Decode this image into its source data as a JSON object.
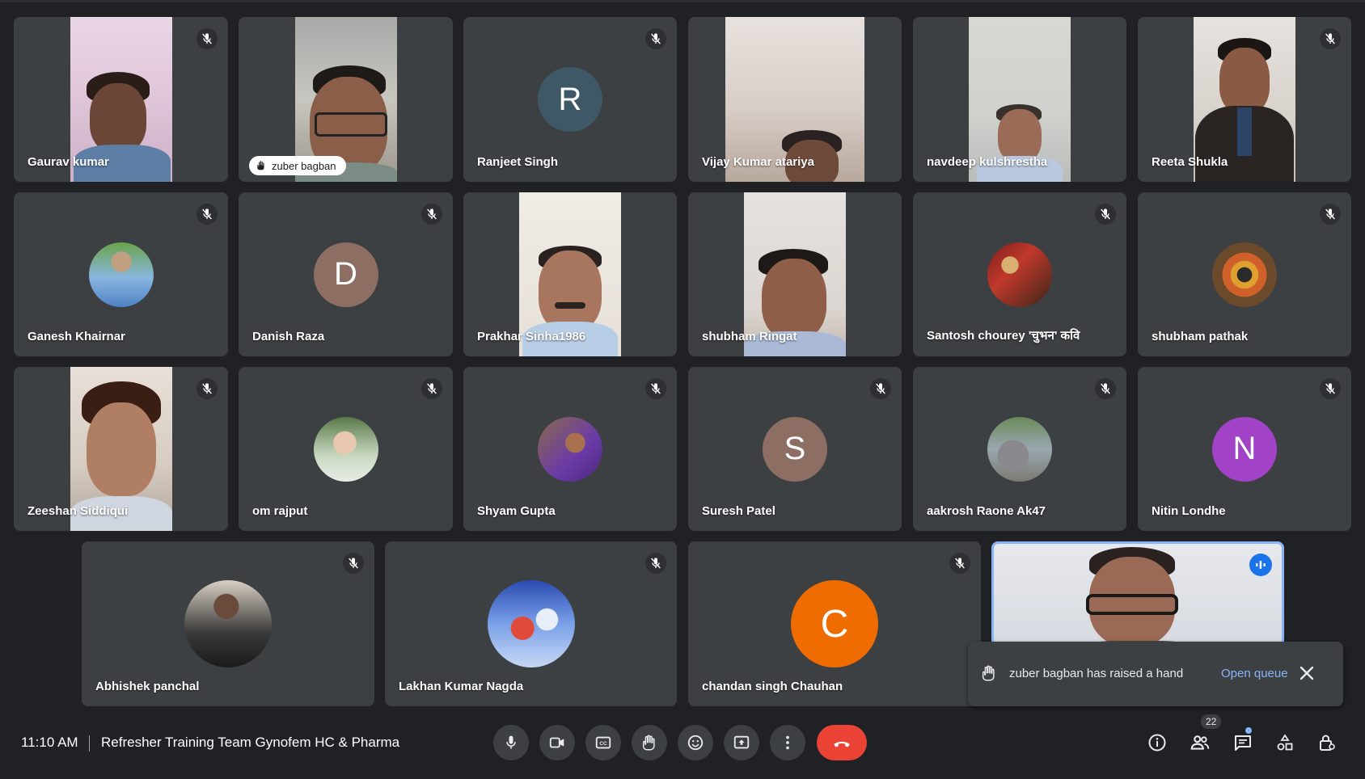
{
  "meeting": {
    "time": "11:10 AM",
    "title": "Refresher Training Team Gynofem HC & Pharma",
    "people_count": "22"
  },
  "participants": [
    {
      "name": "Gaurav kumar",
      "kind": "video"
    },
    {
      "name": "zuber bagban",
      "kind": "video",
      "hand_raised": true
    },
    {
      "name": "Ranjeet Singh",
      "kind": "letter",
      "letter": "R",
      "color": "#3f5868"
    },
    {
      "name": "Vijay Kumar atariya",
      "kind": "video"
    },
    {
      "name": "navdeep kulshrestha",
      "kind": "video"
    },
    {
      "name": "Reeta Shukla",
      "kind": "video"
    },
    {
      "name": "Ganesh Khairnar",
      "kind": "photo"
    },
    {
      "name": "Danish Raza",
      "kind": "letter",
      "letter": "D",
      "color": "#8d6e63"
    },
    {
      "name": "Prakhar Sinha1986",
      "kind": "video"
    },
    {
      "name": "shubham Ringat",
      "kind": "video"
    },
    {
      "name": "Santosh chourey 'चुभन' कवि",
      "kind": "photo"
    },
    {
      "name": "shubham pathak",
      "kind": "photo"
    },
    {
      "name": "Zeeshan Siddiqui",
      "kind": "video"
    },
    {
      "name": "om rajput",
      "kind": "photo"
    },
    {
      "name": "Shyam Gupta",
      "kind": "photo"
    },
    {
      "name": "Suresh Patel",
      "kind": "letter",
      "letter": "S",
      "color": "#8d6e63"
    },
    {
      "name": "aakrosh Raone Ak47",
      "kind": "photo"
    },
    {
      "name": "Nitin Londhe",
      "kind": "letter",
      "letter": "N",
      "color": "#a142c7"
    },
    {
      "name": "Abhishek panchal",
      "kind": "photo"
    },
    {
      "name": "Lakhan Kumar Nagda",
      "kind": "photo"
    },
    {
      "name": "chandan singh Chauhan",
      "kind": "letter",
      "letter": "C",
      "color": "#ef6c00"
    },
    {
      "name": "",
      "kind": "video",
      "speaking": true
    }
  ],
  "toast": {
    "message": "zuber bagban has raised a hand",
    "action": "Open queue"
  },
  "icons": [
    "mic-icon",
    "camera-icon",
    "captions-icon",
    "raise-hand-icon",
    "emoji-icon",
    "present-icon",
    "more-options-icon",
    "end-call-icon",
    "info-icon",
    "people-icon",
    "chat-icon",
    "activities-icon",
    "host-controls-icon"
  ]
}
